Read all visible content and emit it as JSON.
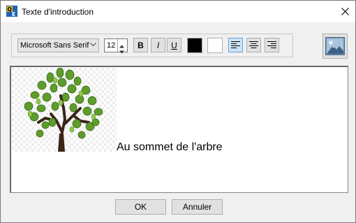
{
  "window": {
    "title": "Texte d'introduction",
    "app_icon_letters": "QE"
  },
  "toolbar": {
    "font_name": "Microsoft Sans Serif",
    "font_size": "12",
    "bold_label": "B",
    "italic_label": "I",
    "underline_label": "U",
    "text_color": "#000000",
    "back_color": "#ffffff",
    "alignment": "left",
    "icons": [
      "chevron-down-icon",
      "spin-up-icon",
      "spin-down-icon",
      "align-left-icon",
      "align-center-icon",
      "align-right-icon",
      "insert-image-icon",
      "close-icon"
    ]
  },
  "editor": {
    "text": "Au sommet de l'arbre"
  },
  "buttons": {
    "ok": "OK",
    "cancel": "Annuler"
  }
}
